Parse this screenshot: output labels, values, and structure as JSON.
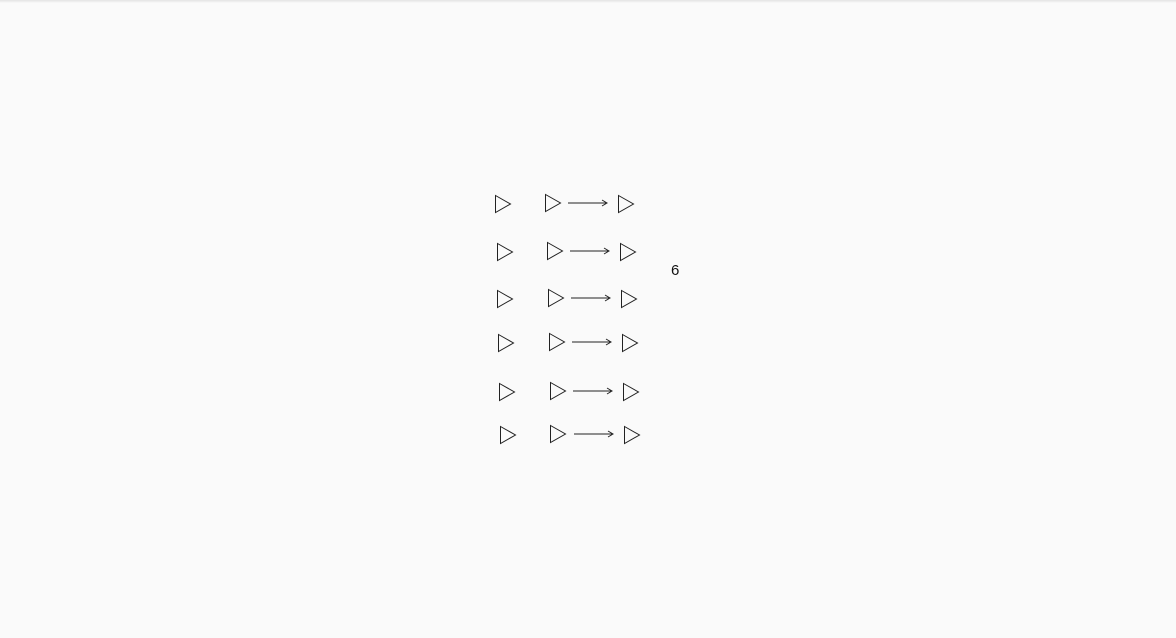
{
  "counter": {
    "value": "6"
  },
  "sequence": {
    "rows": [
      {
        "icon_start": "play-triangle-icon",
        "icon_from": "play-triangle-icon",
        "connector": "arrow-right-icon",
        "icon_to": "play-triangle-icon"
      },
      {
        "icon_start": "play-triangle-icon",
        "icon_from": "play-triangle-icon",
        "connector": "arrow-right-icon",
        "icon_to": "play-triangle-icon"
      },
      {
        "icon_start": "play-triangle-icon",
        "icon_from": "play-triangle-icon",
        "connector": "arrow-right-icon",
        "icon_to": "play-triangle-icon"
      },
      {
        "icon_start": "play-triangle-icon",
        "icon_from": "play-triangle-icon",
        "connector": "arrow-right-icon",
        "icon_to": "play-triangle-icon"
      },
      {
        "icon_start": "play-triangle-icon",
        "icon_from": "play-triangle-icon",
        "connector": "arrow-right-icon",
        "icon_to": "play-triangle-icon"
      },
      {
        "icon_start": "play-triangle-icon",
        "icon_from": "play-triangle-icon",
        "connector": "arrow-right-icon",
        "icon_to": "play-triangle-icon"
      }
    ]
  },
  "colors": {
    "background": "#fafafa",
    "stroke": "#222222"
  }
}
